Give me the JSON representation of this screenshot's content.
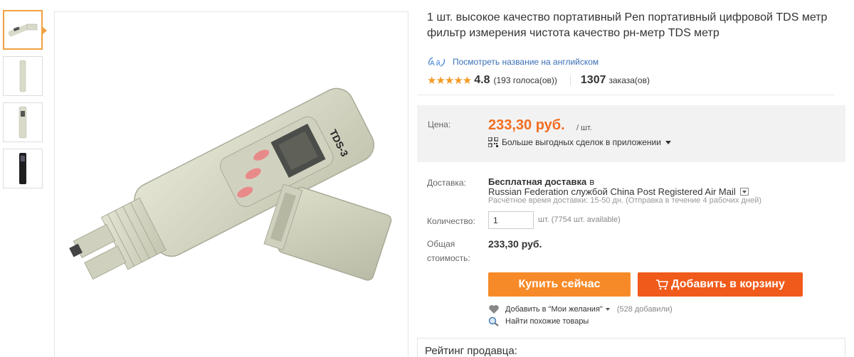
{
  "product": {
    "title": "1 шт. высокое качество портативный Pen портативный цифровой TDS метр фильтр измерения чистота качество рн-метр TDS метр",
    "translate_link": "Посмотреть название на английском",
    "translate_icon_label": "A й",
    "rating": {
      "stars": "★★★★★",
      "value": "4.8",
      "votes": "(193 голоса(ов))"
    },
    "orders": {
      "count": "1307",
      "label": "заказа(ов)"
    }
  },
  "price": {
    "label": "Цена:",
    "value": "233,30 руб.",
    "unit": "/ шт.",
    "deals_text": "Больше выгодных сделок в приложении"
  },
  "shipping": {
    "label": "Доставка:",
    "title": "Бесплатная доставка",
    "in_word": "в",
    "destination": "Russian Federation службой China Post Registered Air Mail",
    "estimate": "Расчётное время доставки: 15-50 дн. (Отправка в течение 4 рабочих дней)"
  },
  "quantity": {
    "label": "Количество:",
    "value": "1",
    "note": "шт. (7754 шт. available)"
  },
  "total": {
    "label_line1": "Общая",
    "label_line2": "стоимость:",
    "value": "233,30 руб."
  },
  "actions": {
    "buy_label": "Купить сейчас",
    "cart_label": "Добавить в корзину",
    "wishlist_label": "Добавить в \"Мои желания\"",
    "wishlist_count": "(528 добавили)",
    "similar_label": "Найти похожие товары"
  },
  "seller": {
    "title": "Рейтинг продавца:"
  },
  "colors": {
    "price": "#f26d21",
    "buy_button": "#f78a28",
    "cart_button": "#f05a1a",
    "stars": "#f59a23",
    "link": "#3a6fb5"
  },
  "icons": [
    "translate-icon",
    "star-icon",
    "qr-code-icon",
    "cart-icon",
    "heart-icon",
    "search-icon",
    "chevron-down-icon"
  ]
}
